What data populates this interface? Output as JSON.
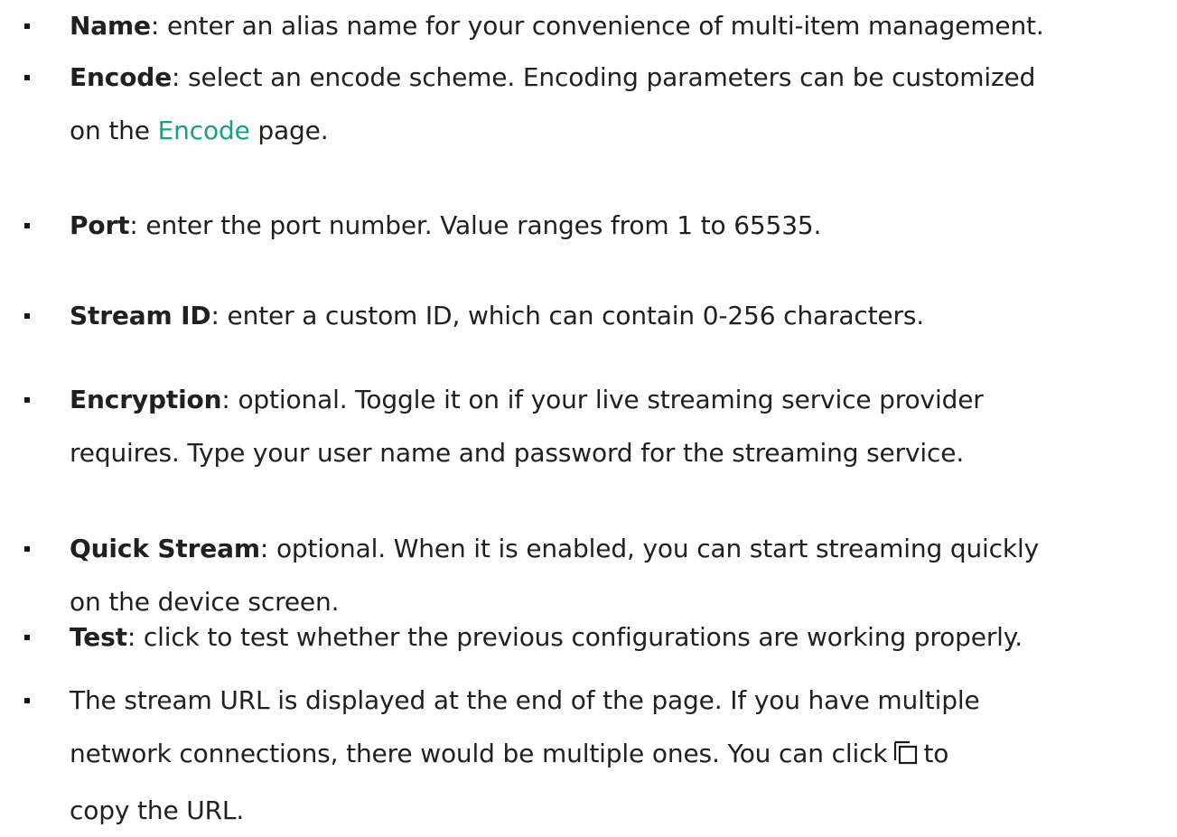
{
  "items": [
    {
      "term": "Name",
      "text": ": enter an alias name for your convenience of multi-item management."
    },
    {
      "term": "Encode",
      "text": ": select an encode scheme. Encoding parameters can be customized",
      "line2_prefix": "on the ",
      "link": "Encode",
      "line2_suffix": " page."
    },
    {
      "term": "Port",
      "text": ": enter the port number. Value ranges from 1 to 65535."
    },
    {
      "term": "Stream ID",
      "text": ": enter a custom ID, which can contain 0-256 characters."
    },
    {
      "term": "Encryption",
      "text": ": optional. Toggle it on if your live streaming service provider",
      "line2": "requires. Type your user name and password for the streaming service."
    },
    {
      "term": "Quick Stream",
      "text": ": optional. When it is enabled, you can start streaming quickly",
      "line2": "on the device screen."
    },
    {
      "term": "Test",
      "text": ": click to test whether the previous configurations are working properly."
    },
    {
      "line1": "The stream URL is displayed at the end of the page. If you have multiple",
      "line2_prefix": "network connections, there would be multiple ones. You can click",
      "copy_icon": "copy-icon",
      "line2_suffix": "to",
      "line3": "copy the URL."
    }
  ],
  "colors": {
    "link": "#16a085",
    "text": "#202020"
  }
}
